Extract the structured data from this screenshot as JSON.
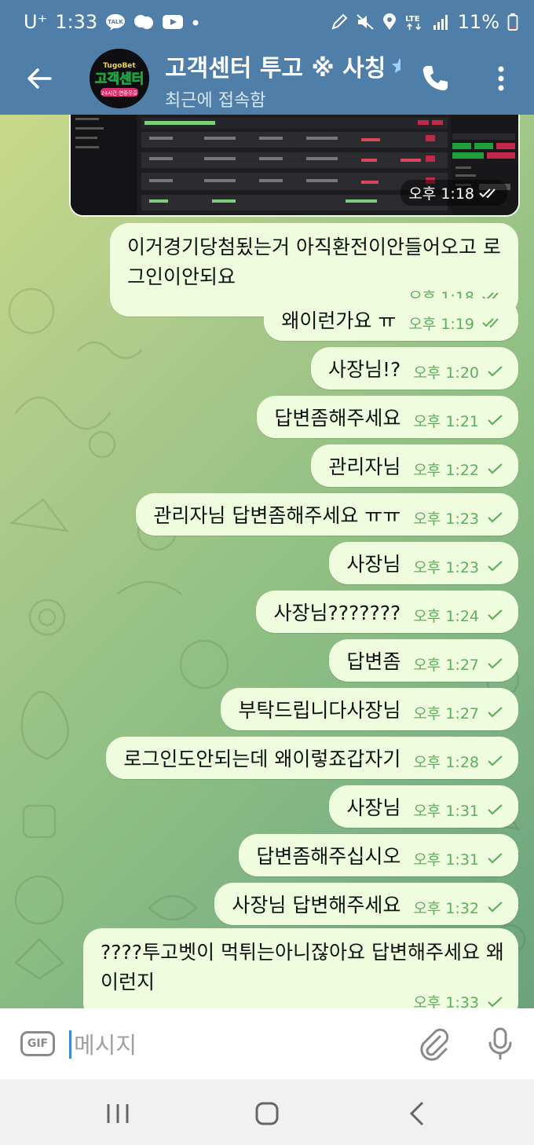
{
  "status_bar": {
    "carrier": "U⁺",
    "time": "1:33",
    "battery": "11%",
    "network": "LTE",
    "icons": [
      "talk-icon",
      "speech-bubble-icon",
      "youtube-icon",
      "dot-icon",
      "pen-icon",
      "mute-icon",
      "location-icon",
      "lte-icon",
      "signal-icon",
      "battery-icon"
    ]
  },
  "header": {
    "title": "고객센터 투고 ※ 사칭",
    "subtitle": "최근에 접속함",
    "avatar_brand": "TugoBet",
    "avatar_text": "고객센터",
    "avatar_tag": "24시간 연중무휴"
  },
  "image_message": {
    "time": "오후 1:18"
  },
  "messages": [
    {
      "text": "이거경기당첨됬는거 아직환전이안들어오고 로그인이안되요",
      "time": "오후 1:18",
      "read": true
    },
    {
      "text": "왜이런가요 ㅠ",
      "time": "오후 1:19",
      "read": true
    },
    {
      "text": "사장님!?",
      "time": "오후 1:20",
      "read": false
    },
    {
      "text": "답변좀해주세요",
      "time": "오후 1:21",
      "read": false
    },
    {
      "text": "관리자님",
      "time": "오후 1:22",
      "read": false
    },
    {
      "text": "관리자님 답변좀해주세요 ㅠㅠ",
      "time": "오후 1:23",
      "read": false
    },
    {
      "text": "사장님",
      "time": "오후 1:23",
      "read": false
    },
    {
      "text": "사장님???????",
      "time": "오후 1:24",
      "read": false
    },
    {
      "text": "답변좀",
      "time": "오후 1:27",
      "read": false
    },
    {
      "text": "부탁드립니다사장님",
      "time": "오후 1:27",
      "read": false
    },
    {
      "text": "로그인도안되는데 왜이렇죠갑자기",
      "time": "오후 1:28",
      "read": false
    },
    {
      "text": "사장님",
      "time": "오후 1:31",
      "read": false
    },
    {
      "text": "답변좀해주십시오",
      "time": "오후 1:31",
      "read": false
    },
    {
      "text": "사장님 답변해주세요",
      "time": "오후 1:32",
      "read": false
    },
    {
      "text": "????투고벳이 먹튀는아니잖아요 답변해주세요 왜이런지",
      "time": "오후 1:33",
      "read": false
    }
  ],
  "composer": {
    "gif_label": "GIF",
    "placeholder": "메시지"
  },
  "colors": {
    "header": "#4f7fa8",
    "bubble": "#effdde",
    "meta": "#5fae60"
  }
}
